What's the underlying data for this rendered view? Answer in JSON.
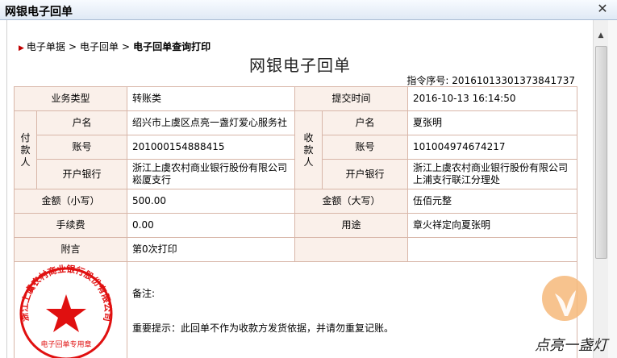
{
  "window": {
    "title": "网银电子回单",
    "close_glyph": "✕"
  },
  "breadcrumb": {
    "items": [
      "电子单据",
      "电子回单"
    ],
    "current": "电子回单查询打印",
    "separator": ">"
  },
  "document": {
    "title": "网银电子回单",
    "serial_label": "指令序号:",
    "serial_value": "20161013301373841737"
  },
  "receipt": {
    "business_type_label": "业务类型",
    "business_type_value": "转账类",
    "submit_time_label": "提交时间",
    "submit_time_value": "2016-10-13 16:14:50",
    "payer": {
      "group_label": "付款人",
      "name_label": "户名",
      "name_value": "绍兴市上虞区点亮一盏灯爱心服务社",
      "account_label": "账号",
      "account_value": "201000154888415",
      "bank_label": "开户银行",
      "bank_value": "浙江上虞农村商业银行股份有限公司崧厦支行"
    },
    "payee": {
      "group_label": "收款人",
      "name_label": "户名",
      "name_value": "夏张明",
      "account_label": "账号",
      "account_value": "101004974674217",
      "bank_label": "开户银行",
      "bank_value": "浙江上虞农村商业银行股份有限公司上浦支行联江分理处"
    },
    "amount_small_label": "金额（小写）",
    "amount_small_value": "500.00",
    "amount_big_label": "金额（大写）",
    "amount_big_value": "伍佰元整",
    "fee_label": "手续费",
    "fee_value": "0.00",
    "purpose_label": "用途",
    "purpose_value": "章火祥定向夏张明",
    "remark_label": "附言",
    "remark_value": "第0次打印",
    "note_label": "备注:",
    "tip_text": "重要提示：此回单不作为收款方发货依据，并请勿重复记账。"
  },
  "seal": {
    "text": "浙江上虞农村商业银行股份有限公司",
    "sub_text": "电子回单专用章",
    "color": "#e01010"
  },
  "logo": {
    "text": "点亮一盏灯"
  },
  "colors": {
    "border": "#d8b6a8",
    "label_bg": "#faf0ea",
    "seal_red": "#e01010"
  }
}
